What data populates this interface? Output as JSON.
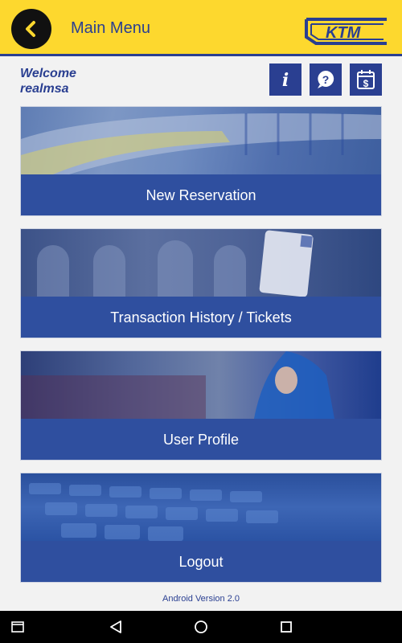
{
  "header": {
    "title": "Main Menu",
    "logo_text": "KTM"
  },
  "welcome": {
    "line1": "Welcome",
    "line2": "realmsa"
  },
  "menu": [
    {
      "label": "New Reservation"
    },
    {
      "label": "Transaction History / Tickets"
    },
    {
      "label": "User Profile"
    },
    {
      "label": "Logout"
    }
  ],
  "footer": {
    "version": "Android Version 2.0"
  },
  "colors": {
    "topbar": "#fdd82e",
    "brand_blue": "#2a3f91",
    "card_label": "#2f4f9f"
  },
  "icons": [
    "back-arrow-icon",
    "info-icon",
    "help-icon",
    "fare-calendar-icon"
  ]
}
